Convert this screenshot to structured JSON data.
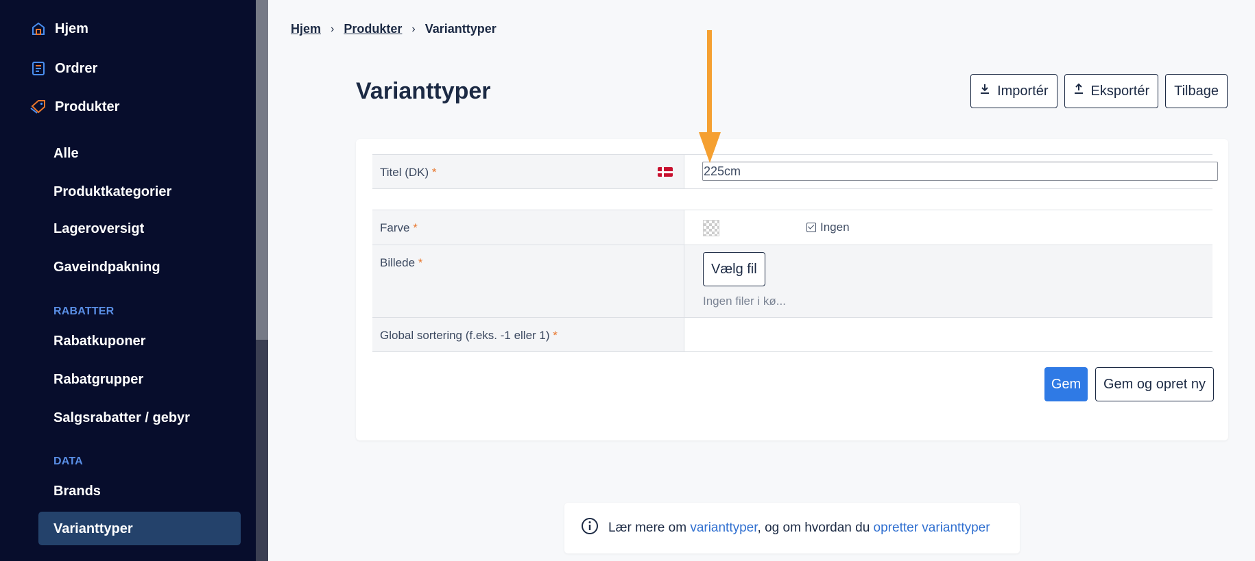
{
  "sidebar": {
    "top_items": [
      {
        "label": "Hjem",
        "icon": "home-icon"
      },
      {
        "label": "Ordrer",
        "icon": "orders-icon"
      },
      {
        "label": "Produkter",
        "icon": "tag-icon"
      }
    ],
    "product_items": [
      "Alle",
      "Produktkategorier",
      "Lageroversigt",
      "Gaveindpakning"
    ],
    "section_rabatter": "RABATTER",
    "rabatter_items": [
      "Rabatkuponer",
      "Rabatgrupper",
      "Salgsrabatter / gebyr"
    ],
    "section_data": "DATA",
    "data_items": [
      "Brands",
      "Varianttyper"
    ]
  },
  "breadcrumb": {
    "home": "Hjem",
    "products": "Produkter",
    "current": "Varianttyper",
    "separator": "›"
  },
  "page": {
    "title": "Varianttyper"
  },
  "actions": {
    "import": "Importér",
    "export": "Eksportér",
    "back": "Tilbage"
  },
  "form": {
    "title_label": "Titel (DK)",
    "title_value": "225cm",
    "required_mark": "*",
    "color_label": "Farve",
    "color_none_label": "Ingen",
    "image_label": "Billede",
    "choose_file": "Vælg fil",
    "file_status": "Ingen filer i kø...",
    "sort_label": "Global sortering (f.eks. -1 eller 1)",
    "save": "Gem",
    "save_new": "Gem og opret ny"
  },
  "info": {
    "text1": "Lær mere om ",
    "link1": "varianttyper",
    "text2": ", og om hvordan du ",
    "link2": "opretter varianttyper"
  },
  "colors": {
    "sidebar_bg": "#070d2c",
    "accent": "#2f7ae5",
    "annotation_arrow": "#f5a031",
    "required": "#e8772e"
  }
}
